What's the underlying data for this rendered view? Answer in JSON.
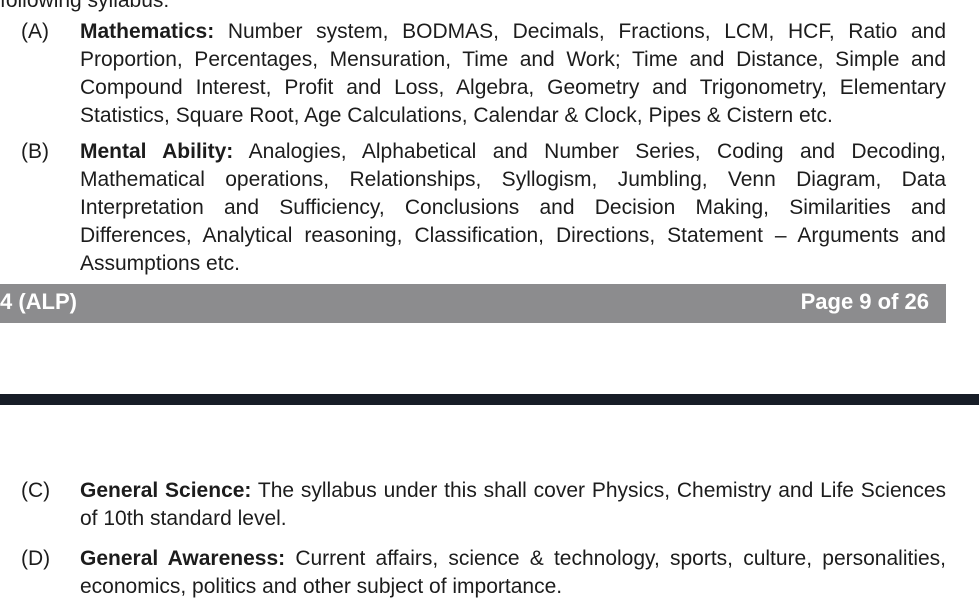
{
  "page1": {
    "cut_line": "following syllabus:",
    "items": [
      {
        "label": "(A)",
        "title": "Mathematics:",
        "text": " Number system, BODMAS, Decimals, Fractions, LCM, HCF, Ratio and Proportion, Percentages, Mensuration, Time and Work; Time and Distance, Simple and Compound Interest, Profit and Loss, Algebra, Geometry and Trigonometry, Elementary Statistics, Square Root, Age Calculations, Calendar & Clock, Pipes & Cistern etc."
      },
      {
        "label": "(B)",
        "title": "Mental Ability:",
        "text": " Analogies, Alphabetical and Number Series, Coding and Decoding, Mathematical operations, Relationships, Syllogism, Jumbling, Venn Diagram, Data Interpretation and Sufficiency, Conclusions and Decision Making, Similarities and Differences, Analytical reasoning, Classification, Directions, Statement – Arguments and Assumptions etc."
      }
    ],
    "footer": {
      "left": "4 (ALP)",
      "right": "Page 9 of 26"
    }
  },
  "page2": {
    "items": [
      {
        "label": "(C)",
        "title": "General Science:",
        "text": " The syllabus under this shall cover Physics, Chemistry and Life Sciences of 10th standard level."
      },
      {
        "label": "(D)",
        "title": "General Awareness:",
        "text": " Current affairs, science & technology, sports, culture, personalities, economics, politics and other subject of importance."
      }
    ]
  }
}
